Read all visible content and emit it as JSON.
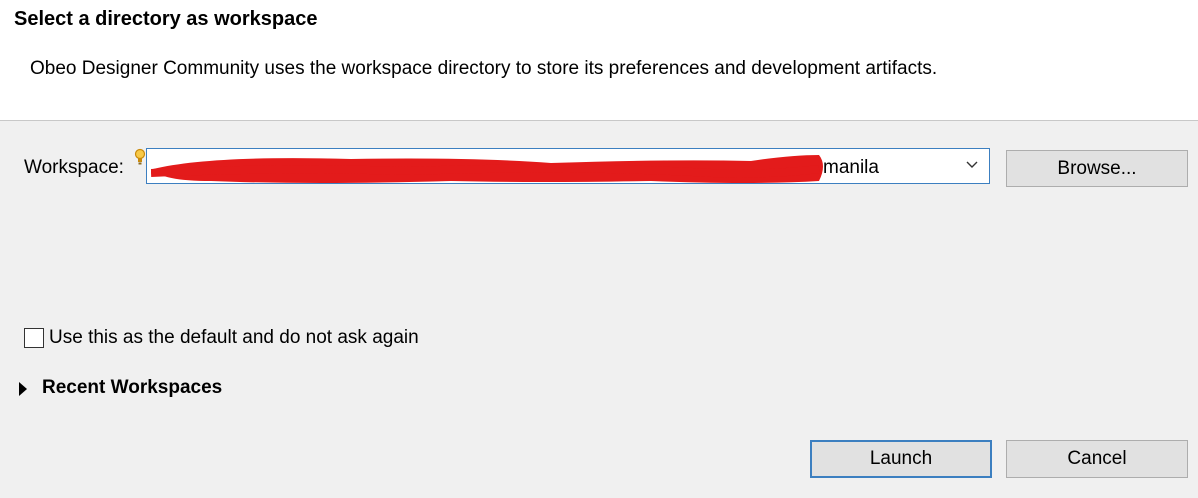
{
  "header": {
    "title": "Select a directory as workspace",
    "message": "Obeo Designer Community uses the workspace directory to store its preferences and development artifacts."
  },
  "workspace": {
    "label": "Workspace:",
    "value_visible_suffix": "manila",
    "redaction_color": "#e31b1b",
    "info_icon": "lightbulb-icon"
  },
  "buttons": {
    "browse": "Browse...",
    "launch": "Launch",
    "cancel": "Cancel"
  },
  "default_checkbox": {
    "label": "Use this as the default and do not ask again",
    "checked": false
  },
  "recent": {
    "label": "Recent Workspaces",
    "expanded": false,
    "toggle_icon": "triangle-right-icon"
  },
  "colors": {
    "accent": "#3c7fc0",
    "dialog_bg": "#f0f0f0",
    "header_bg": "#ffffff"
  }
}
